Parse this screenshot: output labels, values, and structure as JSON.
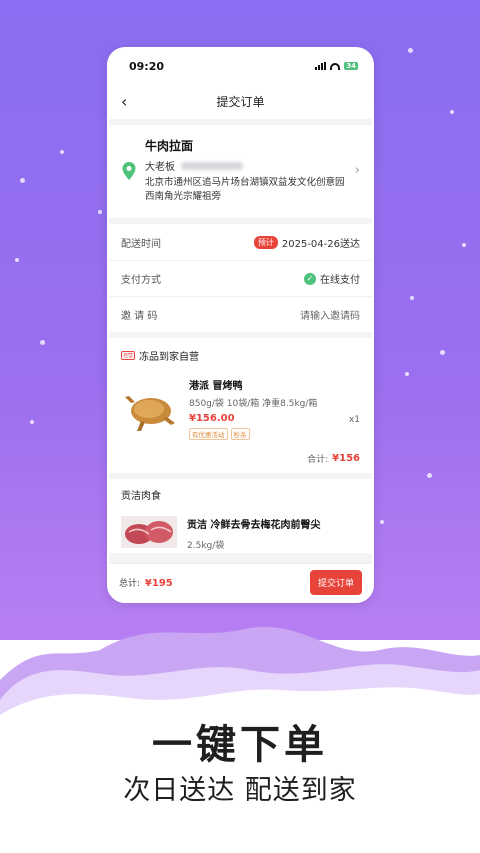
{
  "status_bar": {
    "time": "09:20",
    "battery": "34"
  },
  "nav": {
    "back_icon": "chevron-left-icon",
    "title": "提交订单"
  },
  "address": {
    "name": "牛肉拉面",
    "contact": "大老板",
    "detail": "北京市通州区追马片场台湖镇双益发文化创意园西南角光宗耀祖旁"
  },
  "delivery": {
    "label": "配送时间",
    "badge": "预计",
    "value": "2025-04-26送达"
  },
  "payment": {
    "label": "支付方式",
    "value": "在线支付"
  },
  "invite": {
    "label": "邀 请 码",
    "placeholder": "请输入邀请码"
  },
  "store1": {
    "tag": "自营",
    "name": "冻品到家自营",
    "item": {
      "name": "港派 冒烤鸭",
      "spec": "850g/袋  10袋/箱  净重8.5kg/箱",
      "price": "¥156.00",
      "tags": [
        "有优惠活动",
        "秒杀"
      ],
      "qty": "x1"
    },
    "subtotal_label": "合计:",
    "subtotal_value": "¥156"
  },
  "store2": {
    "name": "贡洁肉食",
    "item": {
      "name": "贡洁 冷鲜去骨去梅花肉前臀尖",
      "spec": "2.5kg/袋"
    }
  },
  "footer": {
    "total_label": "总计:",
    "total_value": "¥195",
    "submit_label": "提交订单"
  },
  "promo": {
    "headline": "一键下单",
    "subline": "次日送达  配送到家"
  },
  "colors": {
    "accent": "#e8433a",
    "bg_purple": "#9b6ff0",
    "success": "#4ec27a"
  }
}
